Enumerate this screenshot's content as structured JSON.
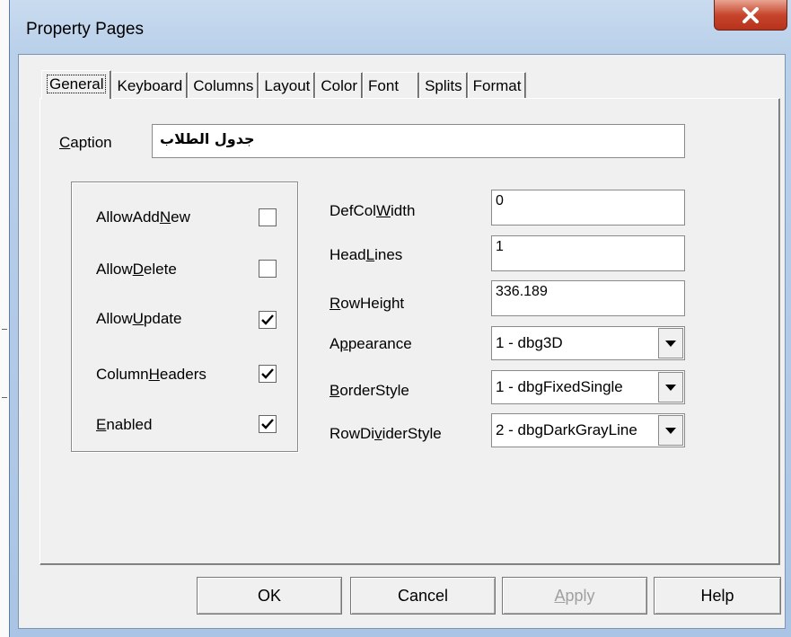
{
  "window": {
    "title": "Property Pages",
    "close_icon": "close-icon"
  },
  "tabs": [
    {
      "label": "General",
      "active": true
    },
    {
      "label": "Keyboard"
    },
    {
      "label": "Columns"
    },
    {
      "label": "Layout"
    },
    {
      "label": "Color"
    },
    {
      "label": "Font"
    },
    {
      "label": "Splits"
    },
    {
      "label": "Format"
    }
  ],
  "caption": {
    "label_u": "C",
    "label_rest": "aption",
    "value": "جدول الطلاب"
  },
  "checkboxes": {
    "allow_add_new": {
      "pre": "AllowAdd",
      "u": "N",
      "post": "ew",
      "checked": false
    },
    "allow_delete": {
      "pre": "Allow",
      "u": "D",
      "post": "elete",
      "checked": false
    },
    "allow_update": {
      "pre": "Allow",
      "u": "U",
      "post": "pdate",
      "checked": true
    },
    "column_headers": {
      "pre": "Column",
      "u": "H",
      "post": "eaders",
      "checked": true
    },
    "enabled": {
      "pre": "",
      "u": "E",
      "post": "nabled",
      "checked": true
    }
  },
  "fields": {
    "def_col_width": {
      "pre": "DefCol",
      "u": "W",
      "post": "idth",
      "value": "0"
    },
    "head_lines": {
      "pre": "Head",
      "u": "L",
      "post": "ines",
      "value": "1"
    },
    "row_height": {
      "pre": "",
      "u": "R",
      "post": "owHeight",
      "value": "336.189"
    },
    "appearance": {
      "pre": "A",
      "u": "p",
      "post": "pearance",
      "value": "1 - dbg3D"
    },
    "border_style": {
      "pre": "",
      "u": "B",
      "post": "orderStyle",
      "value": "1 - dbgFixedSingle"
    },
    "row_divider_style": {
      "pre": "RowDi",
      "u": "v",
      "post": "iderStyle",
      "value": "2 - dbgDarkGrayLine"
    }
  },
  "buttons": {
    "ok": "OK",
    "cancel": "Cancel",
    "apply_u": "A",
    "apply_rest": "pply",
    "help": "Help"
  }
}
